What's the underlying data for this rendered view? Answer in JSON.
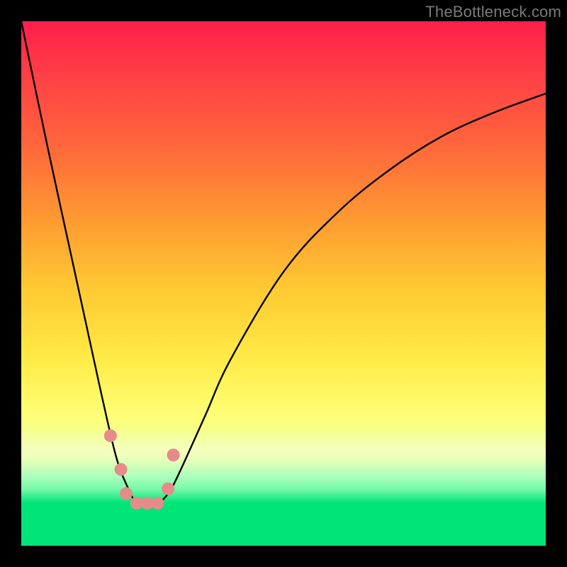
{
  "watermark": "TheBottleneck.com",
  "colors": {
    "frame": "#000000",
    "green": "#00E478",
    "curve": "#000000",
    "marker": "#E78A8A"
  },
  "chart_data": {
    "type": "line",
    "title": "",
    "xlabel": "",
    "ylabel": "",
    "xlim": [
      0,
      100
    ],
    "ylim": [
      0,
      100
    ],
    "series": [
      {
        "name": "bottleneck-curve",
        "x": [
          0,
          5,
          10,
          15,
          18,
          20,
          22,
          24,
          26,
          28,
          30,
          35,
          40,
          50,
          60,
          70,
          80,
          90,
          100
        ],
        "y": [
          100,
          74,
          49,
          24,
          10,
          4,
          0,
          0,
          0,
          2,
          6,
          18,
          30,
          48,
          60,
          69,
          76,
          81,
          85
        ]
      }
    ],
    "markers": {
      "name": "highlighted-points",
      "x": [
        17,
        19,
        20,
        22,
        24,
        26,
        28,
        29
      ],
      "y": [
        14,
        7,
        2,
        0,
        0,
        0,
        3,
        10
      ]
    },
    "gradient_stops": [
      {
        "pos": 0.0,
        "color": "rgb(255,30,75)"
      },
      {
        "pos": 0.55,
        "color": "rgb(255,200,50)"
      },
      {
        "pos": 0.82,
        "color": "rgb(255,255,120)"
      },
      {
        "pos": 1.0,
        "color": "rgb(0,228,120)"
      }
    ]
  }
}
